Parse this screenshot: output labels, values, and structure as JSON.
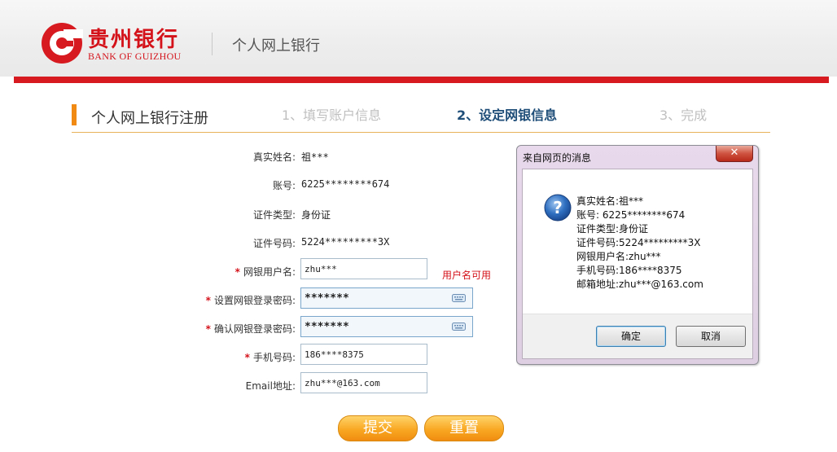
{
  "header": {
    "brand_cn": "贵州银行",
    "brand_en": "BANK OF GUIZHOU",
    "subtitle": "个人网上银行"
  },
  "page": {
    "title": "个人网上银行注册",
    "steps": [
      {
        "label": "1、填写账户信息",
        "state": "done"
      },
      {
        "label": "2、设定网银信息",
        "state": "active"
      },
      {
        "label": "3、完成",
        "state": "pending"
      }
    ]
  },
  "form": {
    "real_name_label": "真实姓名:",
    "real_name_value": "祖***",
    "account_label": "账号:",
    "account_value": "6225********674",
    "id_type_label": "证件类型:",
    "id_type_value": "身份证",
    "id_number_label": "证件号码:",
    "id_number_value": "5224*********3X",
    "username_label": "网银用户名:",
    "username_value": "zhu***",
    "username_hint": "用户名可用",
    "password_label": "设置网银登录密码:",
    "password_value": "*******",
    "confirm_label": "确认网银登录密码:",
    "confirm_value": "*******",
    "mobile_label": "手机号码:",
    "mobile_value": "186****8375",
    "email_label": "Email地址:",
    "email_value": "zhu***@163.com",
    "required_mark": "*"
  },
  "buttons": {
    "submit": "提交",
    "reset": "重置"
  },
  "dialog": {
    "title": "来自网页的消息",
    "close": "✕",
    "lines": [
      "真实姓名:祖***",
      "账号: 6225********674",
      "证件类型:身份证",
      "证件号码:5224*********3X",
      "网银用户名:zhu***",
      "手机号码:186****8375",
      "邮箱地址:zhu***@163.com"
    ],
    "ok": "确定",
    "cancel": "取消",
    "icon": "question-icon"
  },
  "colors": {
    "brand_red": "#d61a1f",
    "accent_orange": "#f08a12",
    "active_step": "#1f4e79"
  }
}
